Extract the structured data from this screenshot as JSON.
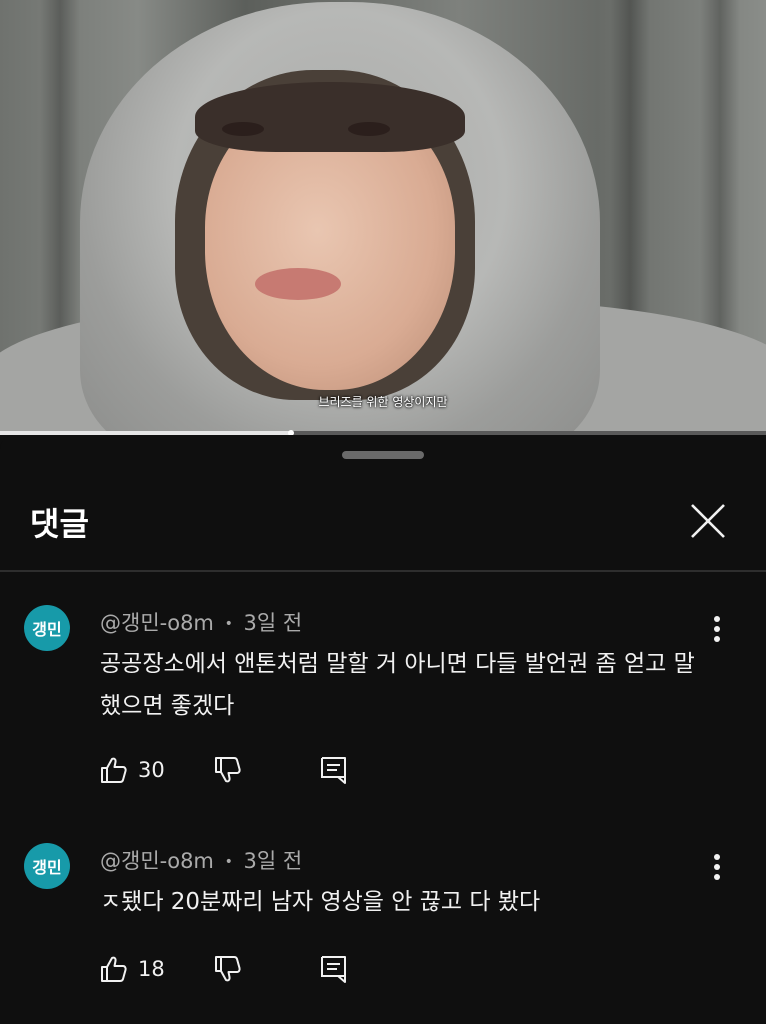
{
  "video": {
    "caption": "브리즈를 위한 영상이지만",
    "progress": 0.38
  },
  "sheet": {
    "title": "댓글",
    "close_icon": "close-icon"
  },
  "comments": [
    {
      "avatar_text": "갱민",
      "author": "@갱민-o8m",
      "separator": "•",
      "time": "3일 전",
      "text": "공공장소에서 앤톤처럼 말할 거 아니면 다들 발언권 좀 얻고 말했으면 좋겠다",
      "likes": "30"
    },
    {
      "avatar_text": "갱민",
      "author": "@갱민-o8m",
      "separator": "•",
      "time": "3일 전",
      "text": "ㅈ됐다 20분짜리 남자 영상을 안 끊고 다 봤다",
      "likes": "18"
    }
  ],
  "colors": {
    "avatar": "#179aa9",
    "background": "#0f0f0f",
    "meta_text": "#aaaaaa"
  },
  "icons": [
    "thumbs-up-icon",
    "thumbs-down-icon",
    "reply-icon",
    "more-vert-icon",
    "close-icon"
  ]
}
